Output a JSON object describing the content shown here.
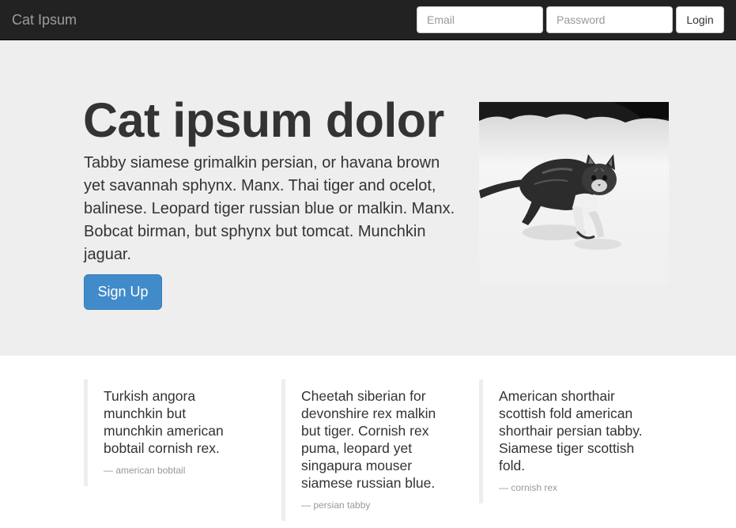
{
  "navbar": {
    "brand": "Cat Ipsum",
    "email_placeholder": "Email",
    "password_placeholder": "Password",
    "login_label": "Login"
  },
  "hero": {
    "title": "Cat ipsum dolor",
    "text": "Tabby siamese grimalkin persian, or havana brown yet savannah sphynx. Manx. Thai tiger and ocelot, balinese. Leopard tiger russian blue or malkin. Manx. Bobcat birman, but sphynx but tomcat. Munchkin jaguar.",
    "signup_label": "Sign Up"
  },
  "quotes": [
    {
      "text": "Turkish angora munchkin but munchkin american bobtail cornish rex.",
      "author": "— american bobtail"
    },
    {
      "text": "Cheetah siberian for devonshire rex malkin but tiger. Cornish rex puma, leopard yet singapura mouser siamese russian blue.",
      "author": "— persian tabby"
    },
    {
      "text": "American shorthair scottish fold american shorthair persian tabby. Siamese tiger scottish fold.",
      "author": "— cornish rex"
    }
  ],
  "colors": {
    "navbar_bg": "#222222",
    "jumbotron_bg": "#eeeeee",
    "primary": "#428bca"
  }
}
